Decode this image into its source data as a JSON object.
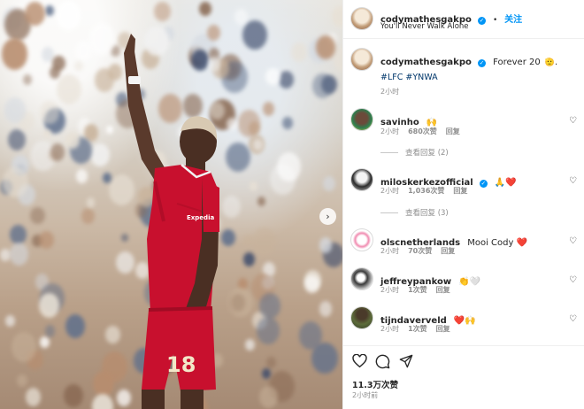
{
  "post": {
    "username": "codymathesgakpo",
    "follow_label": "关注",
    "song": "You'll Never Walk Alone",
    "caption_text": "Forever 20",
    "hashtags": "#LFC #YNWA",
    "caption_time": "2小时",
    "likes": "11.3万次赞",
    "posted_time": "2小时前",
    "shirt_number": "18",
    "shirt_sponsor": "Expedia"
  },
  "comments": [
    {
      "username": "savinho",
      "text": "🙌",
      "time": "2小时",
      "likes": "680次赞",
      "reply": "回复",
      "view_replies": "查看回复 (2)"
    },
    {
      "username": "miloskerkezofficial",
      "text": "🙏❤️",
      "time": "2小时",
      "likes": "1,036次赞",
      "reply": "回复",
      "view_replies": "查看回复 (3)"
    },
    {
      "username": "olscnetherlands",
      "text": "Mooi Cody ❤️",
      "time": "2小时",
      "likes": "70次赞",
      "reply": "回复"
    },
    {
      "username": "jeffreypankow",
      "text": "👏🤍",
      "time": "2小时",
      "likes": "1次赞",
      "reply": "回复"
    },
    {
      "username": "tijndaverveld",
      "text": "❤️🙌",
      "time": "2小时",
      "likes": "1次赞",
      "reply": "回复"
    }
  ],
  "icons": {
    "verified": "verified-badge-icon",
    "like": "heart-outline-icon",
    "comment": "speech-bubble-icon",
    "share": "paper-plane-icon",
    "next": "chevron-right-icon"
  },
  "colors": {
    "accent": "#0095f6",
    "text": "#262626",
    "muted": "#8e8e8e",
    "hashtag": "#00376b",
    "shirt": "#c8102e"
  }
}
